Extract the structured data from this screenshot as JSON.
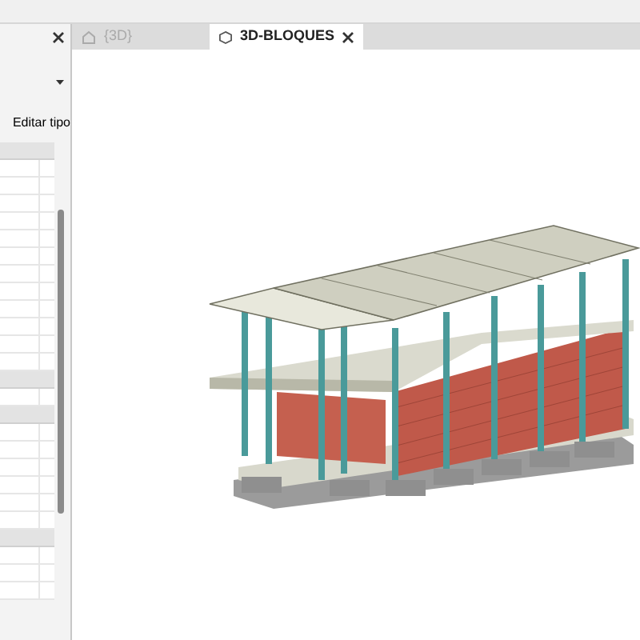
{
  "tabs": [
    {
      "label": "{3D}",
      "selected": false
    },
    {
      "label": "3D-BLOQUES",
      "selected": true
    }
  ],
  "properties": {
    "edit_type_button": "Editar tipo"
  }
}
